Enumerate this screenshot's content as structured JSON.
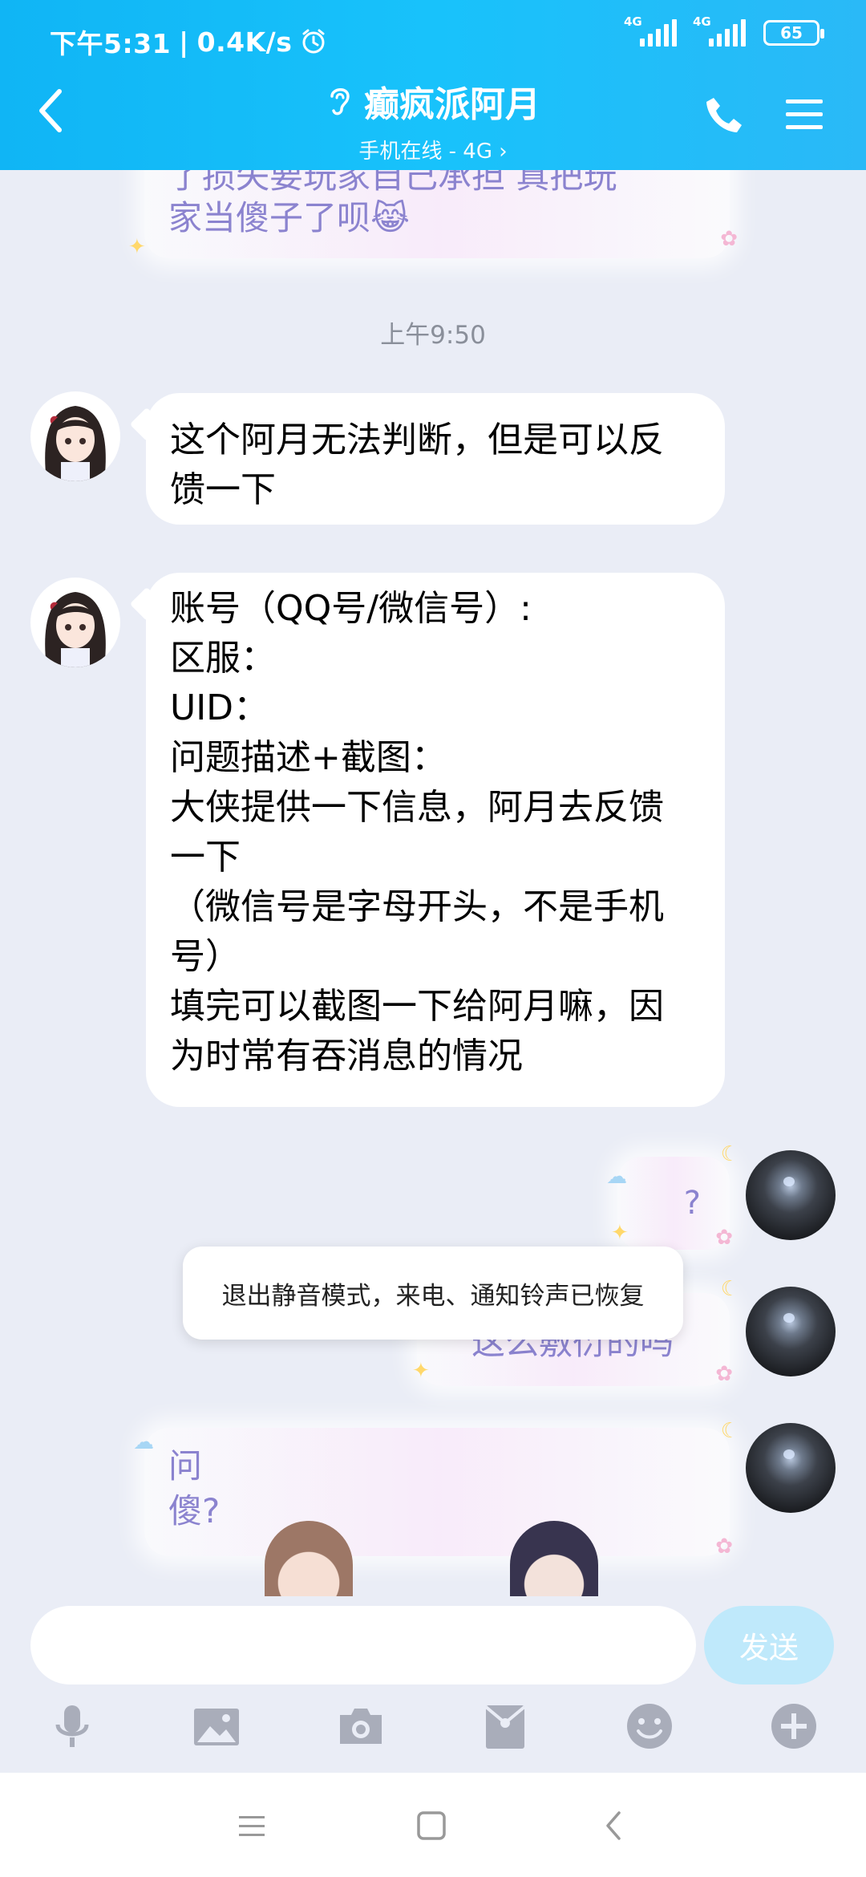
{
  "status_bar": {
    "time": "下午5:31",
    "speed": "0.4K/s",
    "sim1": "4G",
    "sim2": "4G",
    "battery": "65"
  },
  "header": {
    "contact_name": "癫疯派阿月",
    "status_line": "手机在线 - 4G"
  },
  "messages": {
    "top_partial": [
      "了损失要玩家自己承担 真把玩",
      "家当傻子了呗😹"
    ],
    "timestamp": "上午9:50",
    "incoming": [
      {
        "lines": [
          "这个阿月无法判断，但是可以反",
          "馈一下"
        ]
      },
      {
        "lines": [
          "账号（QQ号/微信号）:",
          "区服：",
          "UID：",
          "问题描述+截图：",
          "大侠提供一下信息，阿月去反馈",
          "一下",
          "（微信号是字母开头，不是手机",
          "号）",
          "填完可以截图一下给阿月嘛，因",
          "为时常有吞消息的情况"
        ]
      }
    ],
    "outgoing": [
      {
        "text": "?"
      },
      {
        "text": "这么敷衍的吗"
      },
      {
        "lines": [
          "问",
          "傻?"
        ]
      }
    ]
  },
  "toast": {
    "text": "退出静音模式，来电、通知铃声已恢复"
  },
  "input_bar": {
    "send_label": "发送",
    "placeholder": ""
  },
  "toolbar": [
    "voice",
    "image",
    "camera",
    "red-packet",
    "emoji",
    "plus"
  ],
  "colors": {
    "header_blue": "#18c2fb",
    "chat_bg": "#eaedf6",
    "send_disabled": "#bfe9fb",
    "fancy_text": "#8b83cf"
  }
}
